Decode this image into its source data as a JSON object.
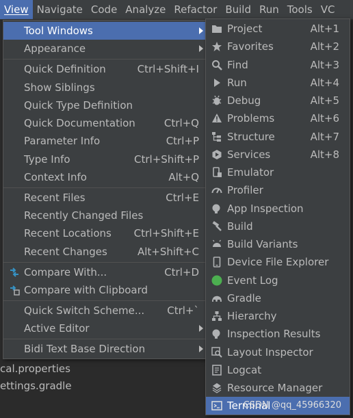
{
  "menubar": {
    "items": [
      {
        "label": "View",
        "active": true
      },
      {
        "label": "Navigate"
      },
      {
        "label": "Code"
      },
      {
        "label": "Analyze"
      },
      {
        "label": "Refactor"
      },
      {
        "label": "Build"
      },
      {
        "label": "Run"
      },
      {
        "label": "Tools"
      },
      {
        "label": "VC"
      }
    ]
  },
  "background": {
    "lines": [
      "cal.properties",
      "ettings.gradle"
    ]
  },
  "view_menu": {
    "items": [
      {
        "label": "Tool Windows",
        "shortcut": "",
        "submenu": true,
        "selected": true
      },
      {
        "label": "Appearance",
        "shortcut": "",
        "submenu": true
      },
      {
        "label": "Quick Definition",
        "shortcut": "Ctrl+Shift+I"
      },
      {
        "label": "Show Siblings",
        "shortcut": ""
      },
      {
        "label": "Quick Type Definition",
        "shortcut": ""
      },
      {
        "label": "Quick Documentation",
        "shortcut": "Ctrl+Q"
      },
      {
        "label": "Parameter Info",
        "shortcut": "Ctrl+P"
      },
      {
        "label": "Type Info",
        "shortcut": "Ctrl+Shift+P"
      },
      {
        "label": "Context Info",
        "shortcut": "Alt+Q"
      },
      {
        "label": "Recent Files",
        "shortcut": "Ctrl+E"
      },
      {
        "label": "Recently Changed Files",
        "shortcut": ""
      },
      {
        "label": "Recent Locations",
        "shortcut": "Ctrl+Shift+E"
      },
      {
        "label": "Recent Changes",
        "shortcut": "Alt+Shift+C"
      },
      {
        "label": "Compare With...",
        "shortcut": "Ctrl+D",
        "icon": "compare-icon"
      },
      {
        "label": "Compare with Clipboard",
        "shortcut": "",
        "icon": "compare-clipboard-icon"
      },
      {
        "label": "Quick Switch Scheme...",
        "shortcut": "Ctrl+`"
      },
      {
        "label": "Active Editor",
        "shortcut": "",
        "submenu": true
      },
      {
        "label": "Bidi Text Base Direction",
        "shortcut": "",
        "submenu": true
      }
    ]
  },
  "tool_windows_menu": {
    "items": [
      {
        "label": "Project",
        "shortcut": "Alt+1",
        "icon": "folder-icon"
      },
      {
        "label": "Favorites",
        "shortcut": "Alt+2",
        "icon": "star-icon"
      },
      {
        "label": "Find",
        "shortcut": "Alt+3",
        "icon": "search-icon"
      },
      {
        "label": "Run",
        "shortcut": "Alt+4",
        "icon": "run-icon"
      },
      {
        "label": "Debug",
        "shortcut": "Alt+5",
        "icon": "bug-icon"
      },
      {
        "label": "Problems",
        "shortcut": "Alt+6",
        "icon": "warning-icon"
      },
      {
        "label": "Structure",
        "shortcut": "Alt+7",
        "icon": "structure-icon"
      },
      {
        "label": "Services",
        "shortcut": "Alt+8",
        "icon": "services-icon"
      },
      {
        "label": "Emulator",
        "shortcut": "",
        "icon": "emulator-icon"
      },
      {
        "label": "Profiler",
        "shortcut": "",
        "icon": "gauge-icon"
      },
      {
        "label": "App Inspection",
        "shortcut": "",
        "icon": "inspection-icon"
      },
      {
        "label": "Build",
        "shortcut": "",
        "icon": "hammer-icon"
      },
      {
        "label": "Build Variants",
        "shortcut": "",
        "icon": "android-icon"
      },
      {
        "label": "Device File Explorer",
        "shortcut": "",
        "icon": "device-icon"
      },
      {
        "label": "Event Log",
        "shortcut": "",
        "icon": "event-log-icon"
      },
      {
        "label": "Gradle",
        "shortcut": "",
        "icon": "elephant-icon"
      },
      {
        "label": "Hierarchy",
        "shortcut": "",
        "icon": "hierarchy-icon"
      },
      {
        "label": "Inspection Results",
        "shortcut": "",
        "icon": "inspection-results-icon"
      },
      {
        "label": "Layout Inspector",
        "shortcut": "",
        "icon": "layout-inspector-icon"
      },
      {
        "label": "Logcat",
        "shortcut": "",
        "icon": "logcat-icon"
      },
      {
        "label": "Resource Manager",
        "shortcut": "",
        "icon": "resource-icon"
      },
      {
        "label": "Terminal",
        "shortcut": "",
        "icon": "terminal-icon",
        "selected": true
      }
    ]
  },
  "watermark": "CSDN @qq_45966320",
  "colors": {
    "menu_bg": "#3c3f41",
    "selection": "#4b6eaf",
    "text": "#bbbbbb",
    "icon": "#afb1b3",
    "event_log_green": "#4caf50"
  }
}
